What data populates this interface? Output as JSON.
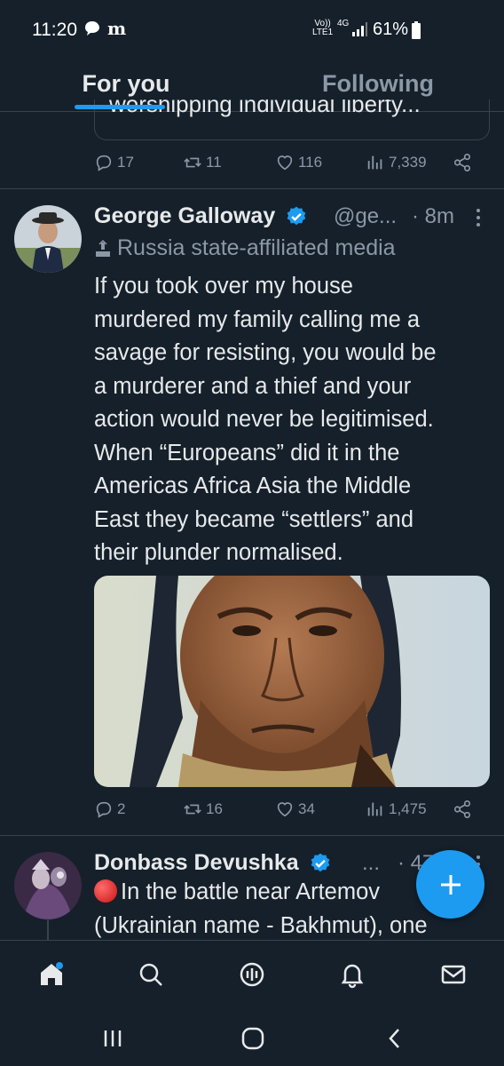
{
  "status_bar": {
    "time": "11:20",
    "network_line1": "Vo))",
    "network_line2": "LTE1",
    "network_type": "4G",
    "battery_percent": "61%",
    "icons": [
      "chat-bubble-icon",
      "m-app-icon",
      "signal-icon",
      "battery-icon"
    ]
  },
  "tabs": [
    {
      "label": "For you",
      "active": true
    },
    {
      "label": "Following",
      "active": false
    }
  ],
  "previous_tweet": {
    "quote_text": "worshipping individual liberty...",
    "stats": {
      "replies": "17",
      "reposts": "11",
      "likes": "116",
      "views": "7,339"
    }
  },
  "tweets": [
    {
      "author": "George Galloway",
      "handle": "@ge...",
      "time": "· 8m",
      "affiliation": "Russia state-affiliated media",
      "body_lines": [
        "If you took over my house",
        "murdered my family calling me a",
        "savage for resisting, you would be",
        "a murderer and a thief and your",
        "action would never be legitimised.",
        "When “Europeans” did it in the",
        "Americas Africa Asia the Middle",
        "East they became “settlers” and",
        "their plunder normalised."
      ],
      "stats": {
        "replies": "2",
        "reposts": "16",
        "likes": "34",
        "views": "1,475"
      }
    },
    {
      "author": "Donbass Devushka",
      "handle": "...",
      "time": "· 47",
      "body_lines": [
        "In the battle near Artemov",
        "(Ukrainian name - Bakhmut), one"
      ]
    }
  ],
  "colors": {
    "background": "#15202b",
    "accent": "#1d9bf0",
    "text_primary": "#e7e9ea",
    "text_secondary": "#8b98a5",
    "border": "#38444d"
  },
  "fab": {
    "icon": "plus-icon"
  },
  "bottom_nav": [
    "home-icon",
    "search-icon",
    "spaces-icon",
    "notifications-icon",
    "messages-icon"
  ],
  "system_nav": [
    "recents-icon",
    "home-button-icon",
    "back-icon"
  ]
}
